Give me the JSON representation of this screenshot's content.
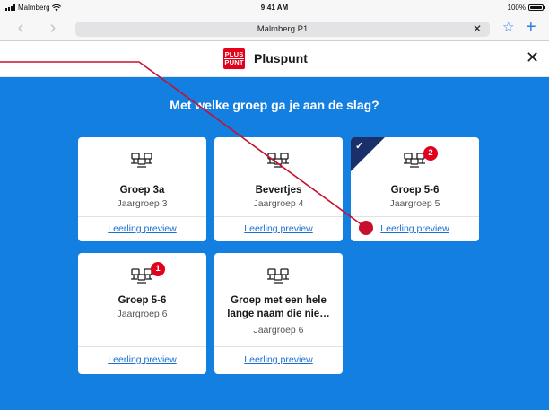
{
  "status_bar": {
    "carrier": "Malmberg",
    "time": "9:41 AM",
    "battery": "100%"
  },
  "browser": {
    "url": "Malmberg P1",
    "back_icon": "chevron-left-icon",
    "forward_icon": "chevron-right-icon",
    "clear_icon": "close-icon",
    "bookmark_icon": "star-icon",
    "new_tab_icon": "plus-icon"
  },
  "app": {
    "logo": {
      "line1": "PLUS",
      "line2": "PUNT",
      "color": "#e2001a"
    },
    "title": "Pluspunt",
    "close_icon": "close-icon"
  },
  "main": {
    "background": "#137fe0",
    "heading": "Met welke groep ga je aan de slag?",
    "cards": [
      {
        "title": "Groep 3a",
        "subtitle": "Jaargroep 3",
        "link": "Leerling preview",
        "badge": null,
        "selected": false
      },
      {
        "title": "Bevertjes",
        "subtitle": "Jaargroep 4",
        "link": "Leerling preview",
        "badge": null,
        "selected": false
      },
      {
        "title": "Groep 5-6",
        "subtitle": "Jaargroep 5",
        "link": "Leerling preview",
        "badge": "2",
        "selected": true
      },
      {
        "title": "Groep 5-6",
        "subtitle": "Jaargroep 6",
        "link": "Leerling preview",
        "badge": "1",
        "selected": false
      },
      {
        "title": "Groep met een hele lange naam die nie…",
        "subtitle": "Jaargroep 6",
        "link": "Leerling preview",
        "badge": null,
        "selected": false
      }
    ]
  },
  "colors": {
    "accent": "#137fe0",
    "badge": "#e2001a",
    "selected_corner": "#1b2f6b",
    "link": "#1b6fd1",
    "annotation": "#c8102e"
  }
}
